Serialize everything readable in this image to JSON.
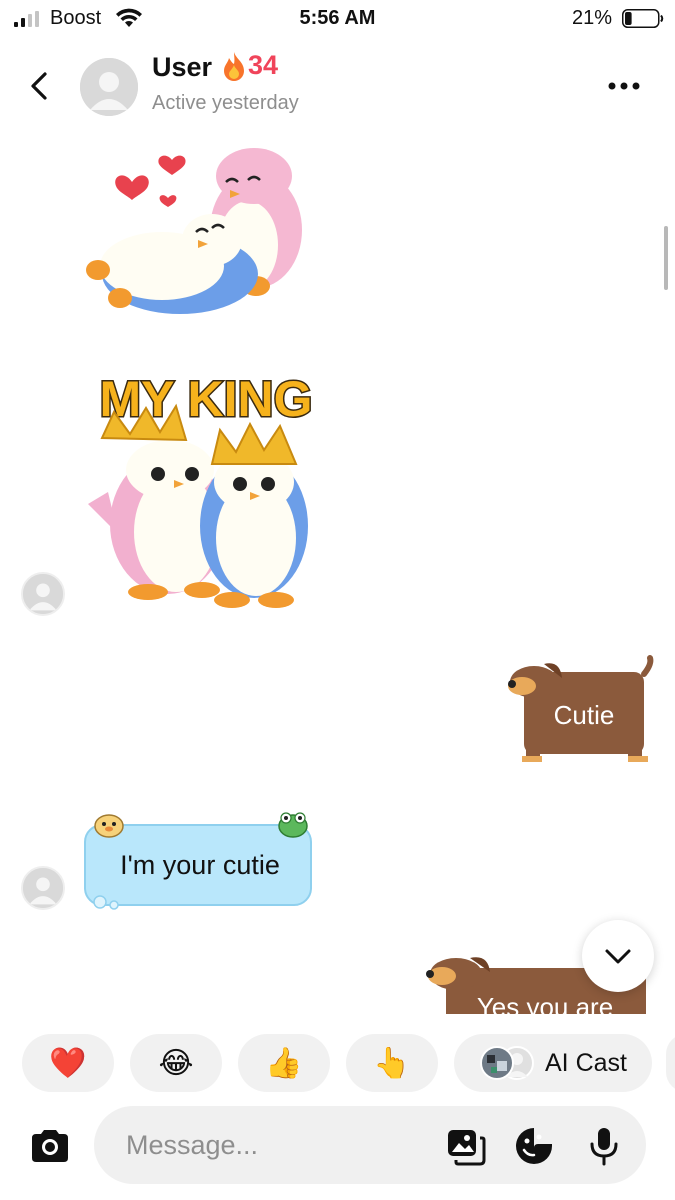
{
  "status_bar": {
    "carrier": "Boost",
    "time": "5:56 AM",
    "battery_percent": "21%",
    "battery_level": 0.21,
    "signal_icon": "signal-bars-icon",
    "wifi_icon": "wifi-icon"
  },
  "header": {
    "user_name": "User",
    "streak_icon": "fire-emoji",
    "streak_count": "34",
    "active_status": "Active yesterday",
    "back_icon": "chevron-left-icon",
    "more_icon": "more-horizontal-icon"
  },
  "messages": [
    {
      "type": "sticker",
      "from": "them",
      "description": "penguins-hug-sticker"
    },
    {
      "type": "sticker",
      "from": "them",
      "text": "MY KING",
      "description": "penguins-crowns-sticker"
    },
    {
      "type": "sticker-text",
      "from": "me",
      "text": "Cutie",
      "description": "dachshund-sign-sticker"
    },
    {
      "type": "text",
      "from": "them",
      "text": "I'm your cutie"
    },
    {
      "type": "sticker-text",
      "from": "me",
      "text": "Yes you are",
      "description": "dachshund-sign-sticker"
    }
  ],
  "reactions": [
    {
      "emoji": "❤️",
      "name": "heart"
    },
    {
      "emoji": "😂",
      "name": "laughing"
    },
    {
      "emoji": "👍",
      "name": "thumbs-up"
    },
    {
      "emoji": "👆",
      "name": "pointing-up"
    }
  ],
  "ai_cast": {
    "label": "AI Cast"
  },
  "composer": {
    "placeholder": "Message...",
    "camera_icon": "camera-icon",
    "gallery_icon": "gallery-icon",
    "sticker_icon": "sticker-icon",
    "mic_icon": "microphone-icon"
  },
  "colors": {
    "streak": "#f0445a",
    "muted_text": "#8e8e8e",
    "bubble_blue": "#b9e7fb",
    "dog_brown": "#8b5a3c"
  }
}
